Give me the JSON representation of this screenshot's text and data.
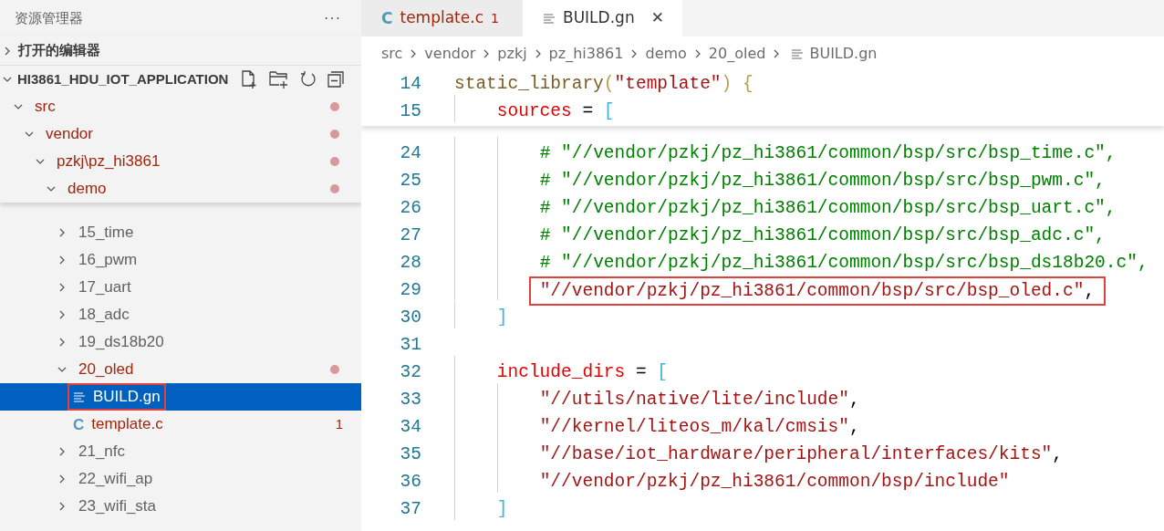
{
  "sidebar": {
    "title": "资源管理器",
    "more": "···",
    "sections": [
      {
        "label": "打开的编辑器",
        "expanded": false
      }
    ],
    "project": {
      "label": "HI3861_HDU_IOT_APPLICATION",
      "expanded": true,
      "tree": [
        {
          "kind": "folder",
          "label": "src",
          "expanded": true,
          "modified": true,
          "selected": false,
          "children": [
            {
              "kind": "folder",
              "label": "vendor",
              "expanded": true,
              "modified": true,
              "selected": false,
              "children": [
                {
                  "kind": "folder",
                  "label": "pzkj\\pz_hi3861",
                  "expanded": true,
                  "modified": true,
                  "selected": false,
                  "children": [
                    {
                      "kind": "folder",
                      "label": "demo",
                      "expanded": true,
                      "modified": true,
                      "selected": false,
                      "children": [
                        {
                          "kind": "folder",
                          "label": "15_time",
                          "expanded": false,
                          "modified": false,
                          "selected": false
                        },
                        {
                          "kind": "folder",
                          "label": "16_pwm",
                          "expanded": false,
                          "modified": false,
                          "selected": false
                        },
                        {
                          "kind": "folder",
                          "label": "17_uart",
                          "expanded": false,
                          "modified": false,
                          "selected": false
                        },
                        {
                          "kind": "folder",
                          "label": "18_adc",
                          "expanded": false,
                          "modified": false,
                          "selected": false
                        },
                        {
                          "kind": "folder",
                          "label": "19_ds18b20",
                          "expanded": false,
                          "modified": false,
                          "selected": false
                        },
                        {
                          "kind": "folder",
                          "label": "20_oled",
                          "expanded": true,
                          "modified": true,
                          "selected": false,
                          "children": [
                            {
                              "kind": "text-file",
                              "label": "BUILD.gn",
                              "selected": true,
                              "highlighted": true
                            },
                            {
                              "kind": "c-file",
                              "icon_text": "C",
                              "label": "template.c",
                              "modified": true,
                              "badge": "1",
                              "selected": false
                            }
                          ]
                        },
                        {
                          "kind": "folder",
                          "label": "21_nfc",
                          "expanded": false,
                          "modified": false,
                          "selected": false
                        },
                        {
                          "kind": "folder",
                          "label": "22_wifi_ap",
                          "expanded": false,
                          "modified": false,
                          "selected": false
                        },
                        {
                          "kind": "folder",
                          "label": "23_wifi_sta",
                          "expanded": false,
                          "modified": false,
                          "selected": false
                        }
                      ]
                    }
                  ]
                }
              ]
            }
          ]
        }
      ]
    }
  },
  "tabs": [
    {
      "kind": "c-file",
      "icon_text": "C",
      "label": "template.c",
      "badge": "1",
      "modified": true,
      "selected": false
    },
    {
      "kind": "text-file",
      "label": "BUILD.gn",
      "close": "✕",
      "modified": false,
      "selected": true
    }
  ],
  "breadcrumb": [
    "src",
    "vendor",
    "pzkj",
    "pz_hi3861",
    "demo",
    "20_oled",
    "BUILD.gn"
  ],
  "sticky_lines": [
    {
      "number": "14",
      "tokens": [
        {
          "kind": "fn",
          "text": "static_library"
        },
        {
          "kind": "paren",
          "text": "("
        },
        {
          "kind": "string",
          "text": "\"template\""
        },
        {
          "kind": "paren",
          "text": ") "
        },
        {
          "kind": "paren",
          "text": "{"
        }
      ]
    },
    {
      "number": "15",
      "tokens": [
        {
          "kind": "var",
          "text": "    sources"
        },
        {
          "kind": "plain",
          "text": " = "
        },
        {
          "kind": "bracket",
          "text": "["
        }
      ]
    }
  ],
  "lines": [
    {
      "number": "24",
      "tokens": [
        {
          "kind": "comment",
          "text": "        # \"//vendor/pzkj/pz_hi3861/common/bsp/src/bsp_time.c\","
        }
      ]
    },
    {
      "number": "25",
      "tokens": [
        {
          "kind": "comment",
          "text": "        # \"//vendor/pzkj/pz_hi3861/common/bsp/src/bsp_pwm.c\","
        }
      ]
    },
    {
      "number": "26",
      "tokens": [
        {
          "kind": "comment",
          "text": "        # \"//vendor/pzkj/pz_hi3861/common/bsp/src/bsp_uart.c\","
        }
      ]
    },
    {
      "number": "27",
      "tokens": [
        {
          "kind": "comment",
          "text": "        # \"//vendor/pzkj/pz_hi3861/common/bsp/src/bsp_adc.c\","
        }
      ]
    },
    {
      "number": "28",
      "tokens": [
        {
          "kind": "comment",
          "text": "        # \"//vendor/pzkj/pz_hi3861/common/bsp/src/bsp_ds18b20.c\","
        }
      ]
    },
    {
      "number": "29",
      "highlighted": true,
      "tokens": [
        {
          "kind": "string",
          "text": "        \"//vendor/pzkj/pz_hi3861/common/bsp/src/bsp_oled.c\""
        },
        {
          "kind": "plain",
          "text": ","
        }
      ]
    },
    {
      "number": "30",
      "tokens": [
        {
          "kind": "bracket",
          "text": "    ]"
        }
      ]
    },
    {
      "number": "31"
    },
    {
      "number": "32",
      "tokens": [
        {
          "kind": "var",
          "text": "    include_dirs"
        },
        {
          "kind": "plain",
          "text": " = "
        },
        {
          "kind": "bracket",
          "text": "["
        }
      ]
    },
    {
      "number": "33",
      "tokens": [
        {
          "kind": "string",
          "text": "        \"//utils/native/lite/include\""
        },
        {
          "kind": "plain",
          "text": ","
        }
      ]
    },
    {
      "number": "34",
      "tokens": [
        {
          "kind": "string",
          "text": "        \"//kernel/liteos_m/kal/cmsis\""
        },
        {
          "kind": "plain",
          "text": ","
        }
      ]
    },
    {
      "number": "35",
      "tokens": [
        {
          "kind": "string",
          "text": "        \"//base/iot_hardware/peripheral/interfaces/kits\""
        },
        {
          "kind": "plain",
          "text": ","
        }
      ]
    },
    {
      "number": "36",
      "tokens": [
        {
          "kind": "string",
          "text": "        \"//vendor/pzkj/pz_hi3861/common/bsp/include\""
        }
      ]
    },
    {
      "number": "37",
      "tokens": [
        {
          "kind": "bracket",
          "text": "    ]"
        }
      ]
    }
  ]
}
